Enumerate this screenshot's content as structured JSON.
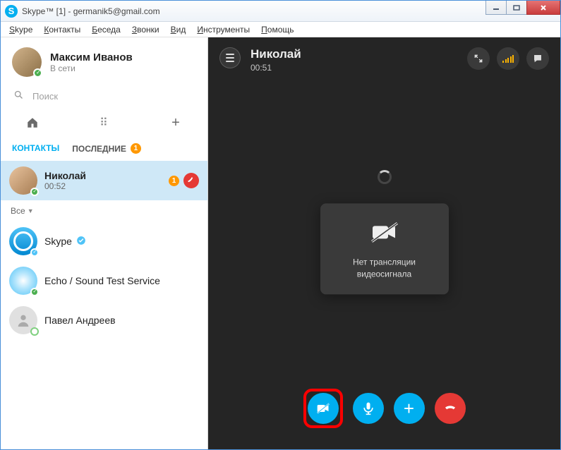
{
  "window": {
    "title": "Skype™ [1] - germanik5@gmail.com"
  },
  "menu": {
    "items": [
      "Skype",
      "Контакты",
      "Беседа",
      "Звонки",
      "Вид",
      "Инструменты",
      "Помощь"
    ]
  },
  "profile": {
    "name": "Максим Иванов",
    "status": "В сети"
  },
  "search": {
    "placeholder": "Поиск"
  },
  "tabs": {
    "contacts": "КОНТАКТЫ",
    "recent": "ПОСЛЕДНИЕ",
    "recent_badge": "1"
  },
  "active_contact": {
    "name": "Николай",
    "time": "00:52",
    "badge": "1"
  },
  "filter": {
    "label": "Все"
  },
  "contacts": [
    {
      "name": "Skype"
    },
    {
      "name": "Echo / Sound Test Service"
    },
    {
      "name": "Павел Андреев"
    }
  ],
  "call": {
    "peer": "Николай",
    "timer": "00:51",
    "no_video": "Нет трансляции\nвидеосигнала"
  }
}
